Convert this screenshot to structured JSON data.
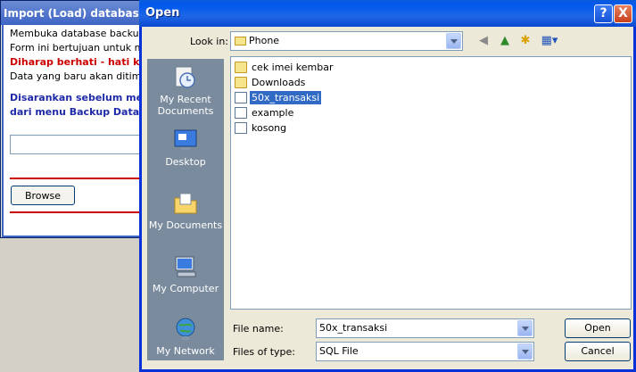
{
  "background_window": {
    "title": "Import (Load) database",
    "lines": [
      "Membuka database backup ya",
      "Form ini bertujuan untuk meng",
      "Diharap berhati - hati kar",
      "Data yang baru akan ditimpa d",
      "Disarankan sebelum mela",
      "dari menu Backup Databa"
    ],
    "browse_label": "Browse"
  },
  "dialog": {
    "title": "Open",
    "look_in_label": "Look in:",
    "look_in_value": "Phone",
    "places": [
      {
        "label_line1": "My Recent",
        "label_line2": "Documents",
        "icon": "recent-documents-icon"
      },
      {
        "label_line1": "Desktop",
        "label_line2": "",
        "icon": "desktop-icon"
      },
      {
        "label_line1": "My Documents",
        "label_line2": "",
        "icon": "my-documents-icon"
      },
      {
        "label_line1": "My Computer",
        "label_line2": "",
        "icon": "my-computer-icon"
      },
      {
        "label_line1": "My Network",
        "label_line2": "",
        "icon": "my-network-icon"
      }
    ],
    "files": [
      {
        "name": "cek imei kembar",
        "type": "folder"
      },
      {
        "name": "Downloads",
        "type": "folder"
      },
      {
        "name": "50x_transaksi",
        "type": "file",
        "selected": true
      },
      {
        "name": "example",
        "type": "file"
      },
      {
        "name": "kosong",
        "type": "file"
      }
    ],
    "file_name_label": "File name:",
    "file_name_value": "50x_transaksi",
    "file_type_label": "Files of type:",
    "file_type_value": "SQL File",
    "open_label": "Open",
    "cancel_label": "Cancel",
    "help_glyph": "?",
    "close_glyph": "X"
  }
}
